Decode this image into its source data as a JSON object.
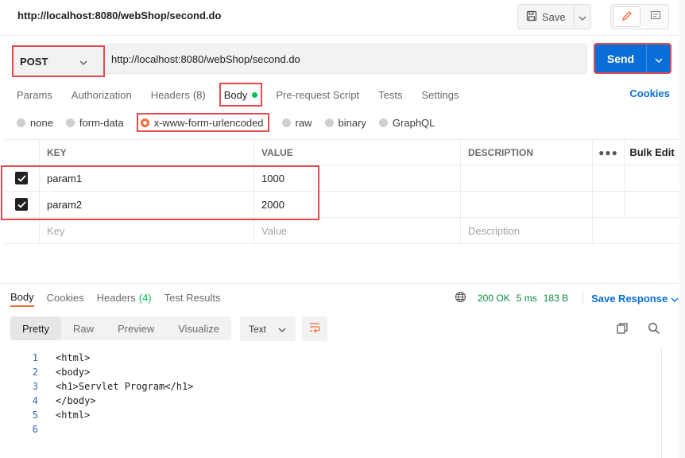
{
  "header": {
    "title": "http://localhost:8080/webShop/second.do",
    "save_label": "Save"
  },
  "request": {
    "method": "POST",
    "url": "http://localhost:8080/webShop/second.do",
    "send_label": "Send"
  },
  "tabs": {
    "params": "Params",
    "authorization": "Authorization",
    "headers": "Headers",
    "headers_count": "(8)",
    "body": "Body",
    "prerequest": "Pre-request Script",
    "tests": "Tests",
    "settings": "Settings",
    "cookies": "Cookies"
  },
  "body_types": {
    "none": "none",
    "form_data": "form-data",
    "urlencoded": "x-www-form-urlencoded",
    "raw": "raw",
    "binary": "binary",
    "graphql": "GraphQL"
  },
  "table": {
    "headers": {
      "key": "KEY",
      "value": "VALUE",
      "description": "DESCRIPTION",
      "bulk_edit": "Bulk Edit"
    },
    "rows": [
      {
        "key": "param1",
        "value": "1000",
        "description": ""
      },
      {
        "key": "param2",
        "value": "2000",
        "description": ""
      }
    ],
    "placeholders": {
      "key": "Key",
      "value": "Value",
      "description": "Description"
    }
  },
  "response": {
    "tabs": {
      "body": "Body",
      "cookies": "Cookies",
      "headers": "Headers",
      "headers_count": "(4)",
      "tests": "Test Results"
    },
    "status": "200 OK",
    "time": "5 ms",
    "size": "183 B",
    "save_response": "Save Response",
    "view_tabs": {
      "pretty": "Pretty",
      "raw": "Raw",
      "preview": "Preview",
      "visualize": "Visualize"
    },
    "format": "Text",
    "code_lines": [
      {
        "n": "1",
        "t": "<html>"
      },
      {
        "n": "2",
        "t": "<body>"
      },
      {
        "n": "3",
        "t": "<h1>Servlet Program</h1>"
      },
      {
        "n": "4",
        "t": "</body>"
      },
      {
        "n": "5",
        "t": "<html>"
      },
      {
        "n": "6",
        "t": ""
      }
    ]
  },
  "colors": {
    "accent": "#0a6ed8",
    "highlight": "#e5484d",
    "success": "#0cbb52",
    "orange": "#f26b3a"
  }
}
